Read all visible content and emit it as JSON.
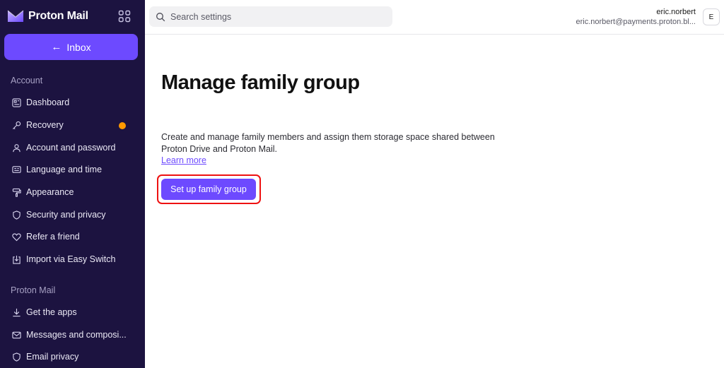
{
  "brand": {
    "name": "Proton Mail"
  },
  "sidebar": {
    "inbox_label": "Inbox",
    "sections": [
      {
        "title": "Account",
        "items": [
          {
            "label": "Dashboard",
            "icon": "dashboard-icon"
          },
          {
            "label": "Recovery",
            "icon": "key-icon",
            "badge": "warning-dot"
          },
          {
            "label": "Account and password",
            "icon": "user-icon"
          },
          {
            "label": "Language and time",
            "icon": "language-icon"
          },
          {
            "label": "Appearance",
            "icon": "paint-roller-icon"
          },
          {
            "label": "Security and privacy",
            "icon": "shield-icon"
          },
          {
            "label": "Refer a friend",
            "icon": "heart-icon"
          },
          {
            "label": "Import via Easy Switch",
            "icon": "import-icon"
          }
        ]
      },
      {
        "title": "Proton Mail",
        "items": [
          {
            "label": "Get the apps",
            "icon": "download-icon"
          },
          {
            "label": "Messages and composi...",
            "icon": "envelope-icon"
          },
          {
            "label": "Email privacy",
            "icon": "shield-icon"
          }
        ]
      }
    ]
  },
  "search": {
    "placeholder": "Search settings"
  },
  "user": {
    "name": "eric.norbert",
    "email": "eric.norbert@payments.proton.bl...",
    "initial": "E"
  },
  "main": {
    "title": "Manage family group",
    "description": "Create and manage family members and assign them storage space shared between Proton Drive and Proton Mail.",
    "learn_more": "Learn more",
    "cta_label": "Set up family group"
  },
  "colors": {
    "sidebar_bg": "#1c1340",
    "accent": "#6d4aff",
    "warning": "#ff9900",
    "highlight": "#ee1111"
  }
}
